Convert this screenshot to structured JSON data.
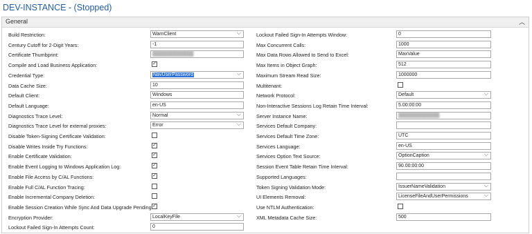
{
  "title": "DEV-INSTANCE - (Stopped)",
  "section": {
    "label": "General",
    "caret_icon": "chevron-up-icon"
  },
  "left": [
    {
      "label": "Build Restriction:",
      "type": "select",
      "value": "WarnClient"
    },
    {
      "label": "Century Cutoff for 2-Digit Years:",
      "type": "text",
      "value": "-1"
    },
    {
      "label": "Certificate Thumbprint:",
      "type": "text",
      "value": "",
      "blurred": true
    },
    {
      "label": "Compile and Load Business Application:",
      "type": "checkbox",
      "checked": true
    },
    {
      "label": "Credential Type:",
      "type": "select",
      "value": "NavUserPassword",
      "highlighted": true
    },
    {
      "label": "Data Cache Size:",
      "type": "text",
      "value": "10"
    },
    {
      "label": "Default Client:",
      "type": "text",
      "value": "Windows"
    },
    {
      "label": "Default Language:",
      "type": "text",
      "value": "en-US"
    },
    {
      "label": "Diagnostics Trace Level:",
      "type": "select",
      "value": "Normal"
    },
    {
      "label": "Diagnostics Trace Level for external proxies:",
      "type": "select",
      "value": "Error"
    },
    {
      "label": "Disable Token-Signing Certificate Validation:",
      "type": "checkbox",
      "checked": false
    },
    {
      "label": "Disable Writes Inside Try Functions:",
      "type": "checkbox",
      "checked": true
    },
    {
      "label": "Enable Certificate Validation:",
      "type": "checkbox",
      "checked": true
    },
    {
      "label": "Enable Event Logging to Windows Application Log:",
      "type": "checkbox",
      "checked": true
    },
    {
      "label": "Enable File Access by C/AL Functions:",
      "type": "checkbox",
      "checked": true
    },
    {
      "label": "Enable Full C/AL Function Tracing:",
      "type": "checkbox",
      "checked": false
    },
    {
      "label": "Enable Incremental Company Deletion:",
      "type": "checkbox",
      "checked": false
    },
    {
      "label": "Enable Session Creation While Sync And Data Upgrade Pending:",
      "type": "checkbox",
      "checked": true
    },
    {
      "label": "Encryption Provider:",
      "type": "select",
      "value": "LocalKeyFile"
    },
    {
      "label": "Lockout Failed Sign-In Attempts Count:",
      "type": "text",
      "value": "0"
    }
  ],
  "right": [
    {
      "label": "Lockout Failed Sign-In Attempts Window:",
      "type": "text",
      "value": "0"
    },
    {
      "label": "Max Concurrent Calls:",
      "type": "text",
      "value": "1000"
    },
    {
      "label": "Max Data Rows Allowed to Send to Excel:",
      "type": "text",
      "value": "MaxValue"
    },
    {
      "label": "Max Items in Object Graph:",
      "type": "text",
      "value": "512"
    },
    {
      "label": "Maximum Stream Read Size:",
      "type": "text",
      "value": "1000000"
    },
    {
      "label": "Multitenant:",
      "type": "checkbox",
      "checked": false
    },
    {
      "label": "Network Protocol:",
      "type": "select",
      "value": "Default"
    },
    {
      "label": "Non-Interactive Sessions Log Retain Time Interval:",
      "type": "text",
      "value": "5.00:00:00"
    },
    {
      "label": "Server Instance Name:",
      "type": "text",
      "value": "",
      "blurred": true
    },
    {
      "label": "Services Default Company:",
      "type": "text",
      "value": ""
    },
    {
      "label": "Services Default Time Zone:",
      "type": "text",
      "value": "UTC"
    },
    {
      "label": "Services Language:",
      "type": "text",
      "value": "en-US"
    },
    {
      "label": "Services Option Text Source:",
      "type": "select",
      "value": "OptionCaption"
    },
    {
      "label": "Session Event Table Retain Time Interval:",
      "type": "text",
      "value": "90.00:00:00"
    },
    {
      "label": "Supported Languages:",
      "type": "text",
      "value": ""
    },
    {
      "label": "Token Signing Validation Mode:",
      "type": "select",
      "value": "IssuerNameValidation"
    },
    {
      "label": "UI Elements Removal:",
      "type": "select",
      "value": "LicenseFileAndUserPermissions"
    },
    {
      "label": "Use NTLM Authentication:",
      "type": "checkbox",
      "checked": false
    },
    {
      "label": "XML Metadata Cache Size:",
      "type": "text",
      "value": "500"
    }
  ]
}
